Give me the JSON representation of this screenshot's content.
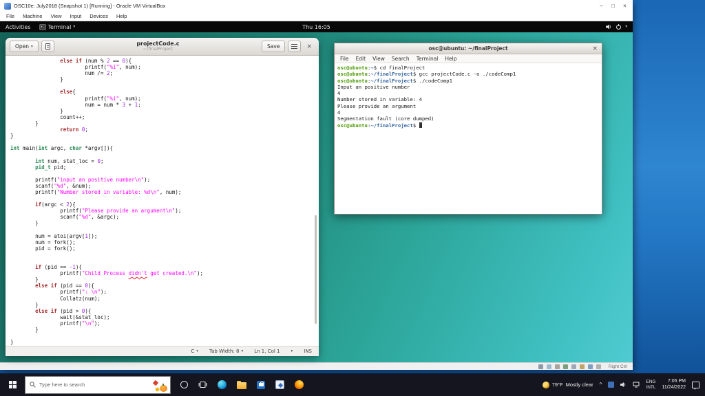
{
  "vbox": {
    "title": "OSC10e: July2018 (Snapshot 1) [Running] - Oracle VM VirtualBox",
    "menu": [
      "File",
      "Machine",
      "View",
      "Input",
      "Devices",
      "Help"
    ],
    "window_buttons": {
      "minimize": "–",
      "maximize": "□",
      "close": "×"
    },
    "status_hint": "Right Ctrl"
  },
  "gnome": {
    "activities": "Activities",
    "app_name": "Terminal",
    "clock": "Thu 16:05"
  },
  "gedit": {
    "open_label": "Open",
    "title": "projectCode.c",
    "subtitle": "~/finalProject",
    "save_label": "Save",
    "close_label": "×",
    "status": {
      "language": "C",
      "tab_width": "Tab Width: 8",
      "position": "Ln 1, Col 1",
      "mode": "INS"
    },
    "code_lines": [
      [
        [
          "",
          "                "
        ],
        [
          "k",
          "else if"
        ],
        [
          "",
          " (num % "
        ],
        [
          "c",
          "2"
        ],
        [
          "",
          " == "
        ],
        [
          "c",
          "0"
        ],
        [
          "",
          "){"
        ]
      ],
      [
        [
          "",
          "                        "
        ],
        [
          "",
          "printf("
        ],
        [
          "s",
          "\"%i\""
        ],
        [
          "",
          ", num);"
        ]
      ],
      [
        [
          "",
          "                        "
        ],
        [
          "",
          "num /= "
        ],
        [
          "c",
          "2"
        ],
        [
          "",
          ";"
        ]
      ],
      [
        [
          "",
          "                "
        ],
        [
          "",
          "}"
        ]
      ],
      [],
      [
        [
          "",
          "                "
        ],
        [
          "k",
          "else"
        ],
        [
          "",
          "{"
        ]
      ],
      [
        [
          "",
          "                        "
        ],
        [
          "",
          "printf("
        ],
        [
          "s",
          "\"%i\""
        ],
        [
          "",
          ", num);"
        ]
      ],
      [
        [
          "",
          "                        "
        ],
        [
          "",
          "num = num * "
        ],
        [
          "c",
          "3"
        ],
        [
          "",
          " + "
        ],
        [
          "c",
          "1"
        ],
        [
          "",
          ";"
        ]
      ],
      [
        [
          "",
          "                "
        ],
        [
          "",
          "}"
        ]
      ],
      [
        [
          "",
          "                "
        ],
        [
          "",
          "count++;"
        ]
      ],
      [
        [
          "",
          "        "
        ],
        [
          "",
          "}"
        ]
      ],
      [
        [
          "",
          "                "
        ],
        [
          "k",
          "return"
        ],
        [
          "",
          " "
        ],
        [
          "c",
          "0"
        ],
        [
          "",
          ";"
        ]
      ],
      [
        [
          "",
          "}"
        ]
      ],
      [],
      [
        [
          "t",
          "int"
        ],
        [
          "",
          " main("
        ],
        [
          "t",
          "int"
        ],
        [
          "",
          " argc, "
        ],
        [
          "t",
          "char"
        ],
        [
          "",
          " *argv[]){"
        ]
      ],
      [],
      [
        [
          "",
          "        "
        ],
        [
          "t",
          "int"
        ],
        [
          "",
          " num, stat_loc = "
        ],
        [
          "c",
          "0"
        ],
        [
          "",
          ";"
        ]
      ],
      [
        [
          "",
          "        "
        ],
        [
          "t",
          "pid_t"
        ],
        [
          "",
          " pid;"
        ]
      ],
      [],
      [
        [
          "",
          "        "
        ],
        [
          "",
          "printf("
        ],
        [
          "s",
          "\"input an positive number\\n\""
        ],
        [
          "",
          ");"
        ]
      ],
      [
        [
          "",
          "        "
        ],
        [
          "",
          "scanf("
        ],
        [
          "s",
          "\"%d\""
        ],
        [
          "",
          ", &num);"
        ]
      ],
      [
        [
          "",
          "        "
        ],
        [
          "",
          "printf("
        ],
        [
          "s",
          "\"Number stored in variable: %d\\n\""
        ],
        [
          "",
          ", num);"
        ]
      ],
      [],
      [
        [
          "",
          "        "
        ],
        [
          "k",
          "if"
        ],
        [
          "",
          "(argc < "
        ],
        [
          "c",
          "2"
        ],
        [
          "",
          "){"
        ]
      ],
      [
        [
          "",
          "                "
        ],
        [
          "",
          "printf("
        ],
        [
          "s",
          "\"Please provide an argument\\n\""
        ],
        [
          "",
          ");"
        ]
      ],
      [
        [
          "",
          "                "
        ],
        [
          "",
          "scanf("
        ],
        [
          "s",
          "\"%d\""
        ],
        [
          "",
          ", &argc);"
        ]
      ],
      [
        [
          "",
          "        "
        ],
        [
          "",
          "}"
        ]
      ],
      [],
      [
        [
          "",
          "        "
        ],
        [
          "",
          "num = atoi(argv["
        ],
        [
          "c",
          "1"
        ],
        [
          "",
          "]);"
        ]
      ],
      [
        [
          "",
          "        "
        ],
        [
          "",
          "num = fork();"
        ]
      ],
      [
        [
          "",
          "        "
        ],
        [
          "",
          "pid = fork();"
        ]
      ],
      [],
      [],
      [
        [
          "",
          "        "
        ],
        [
          "k",
          "if"
        ],
        [
          "",
          " (pid == "
        ],
        [
          "c",
          "-1"
        ],
        [
          "",
          "){"
        ]
      ],
      [
        [
          "",
          "                "
        ],
        [
          "",
          "printf("
        ],
        [
          "s",
          "\"Child Process "
        ],
        [
          "m",
          "didn't"
        ],
        [
          "s",
          " get created.\\n\""
        ],
        [
          "",
          ");"
        ]
      ],
      [
        [
          "",
          "        "
        ],
        [
          "",
          "}"
        ]
      ],
      [
        [
          "",
          "        "
        ],
        [
          "k",
          "else if"
        ],
        [
          "",
          " (pid == "
        ],
        [
          "c",
          "0"
        ],
        [
          "",
          "){"
        ]
      ],
      [
        [
          "",
          "                "
        ],
        [
          "",
          "printf("
        ],
        [
          "s",
          "\": \\n\""
        ],
        [
          "",
          ");"
        ]
      ],
      [
        [
          "",
          "                "
        ],
        [
          "",
          "Collatz(num);"
        ]
      ],
      [
        [
          "",
          "        "
        ],
        [
          "",
          "}"
        ]
      ],
      [
        [
          "",
          "        "
        ],
        [
          "k",
          "else if"
        ],
        [
          "",
          " (pid > "
        ],
        [
          "c",
          "0"
        ],
        [
          "",
          "){"
        ]
      ],
      [
        [
          "",
          "                "
        ],
        [
          "",
          "wait(&stat_loc);"
        ]
      ],
      [
        [
          "",
          "                "
        ],
        [
          "",
          "printf("
        ],
        [
          "s",
          "\"\\n\""
        ],
        [
          "",
          ");"
        ]
      ],
      [
        [
          "",
          "        "
        ],
        [
          "",
          "}"
        ]
      ],
      [],
      [
        [
          "",
          "}"
        ]
      ]
    ]
  },
  "terminal": {
    "title": "osc@ubuntu: ~/finalProject",
    "close_label": "×",
    "menu": [
      "File",
      "Edit",
      "View",
      "Search",
      "Terminal",
      "Help"
    ],
    "lines": [
      [
        [
          "p",
          "osc@ubuntu"
        ],
        [
          "",
          ":"
        ],
        [
          "d",
          "~"
        ],
        [
          "",
          "$ cd finalProject"
        ]
      ],
      [
        [
          "p",
          "osc@ubuntu"
        ],
        [
          "",
          ":"
        ],
        [
          "d",
          "~/finalProject"
        ],
        [
          "",
          "$ gcc projectCode.c -o ./codeComp1"
        ]
      ],
      [
        [
          "p",
          "osc@ubuntu"
        ],
        [
          "",
          ":"
        ],
        [
          "d",
          "~/finalProject"
        ],
        [
          "",
          "$ ./codeComp1"
        ]
      ],
      [
        [
          "",
          "Input an positive number"
        ]
      ],
      [
        [
          "",
          "4"
        ]
      ],
      [
        [
          "",
          "Number stored in variable: 4"
        ]
      ],
      [
        [
          "",
          "Please provide an argument"
        ]
      ],
      [
        [
          "",
          "4"
        ]
      ],
      [
        [
          "",
          "Segmentation fault (core dumped)"
        ]
      ],
      [
        [
          "p",
          "osc@ubuntu"
        ],
        [
          "",
          ":"
        ],
        [
          "d",
          "~/finalProject"
        ],
        [
          "",
          "$ "
        ]
      ]
    ]
  },
  "taskbar": {
    "search_placeholder": "Type here to search",
    "weather_temp": "79°F",
    "weather_desc": "Mostly clear",
    "language": [
      "ENG",
      "INTL"
    ],
    "time": "7:05 PM",
    "date": "11/24/2022"
  },
  "colors": {
    "desktop_teal_start": "#16655b",
    "desktop_teal_end": "#4fcbd1",
    "windows_blue": "#2f86d0",
    "code_keyword": "#a52a2a",
    "code_type": "#2e8b57",
    "code_string": "#ff00ff",
    "code_number": "#a020f0",
    "prompt_user": "#4e9a06",
    "prompt_path": "#3465a4"
  }
}
